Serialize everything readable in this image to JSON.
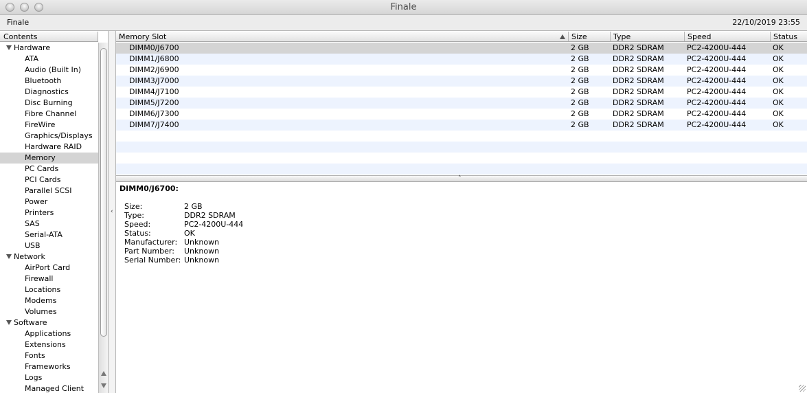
{
  "window": {
    "title": "Finale",
    "machine_name": "Finale",
    "datetime": "22/10/2019 23:55"
  },
  "sidebar": {
    "header": "Contents",
    "categories": [
      {
        "label": "Hardware",
        "items": [
          "ATA",
          "Audio (Built In)",
          "Bluetooth",
          "Diagnostics",
          "Disc Burning",
          "Fibre Channel",
          "FireWire",
          "Graphics/Displays",
          "Hardware RAID",
          "Memory",
          "PC Cards",
          "PCI Cards",
          "Parallel SCSI",
          "Power",
          "Printers",
          "SAS",
          "Serial-ATA",
          "USB"
        ]
      },
      {
        "label": "Network",
        "items": [
          "AirPort Card",
          "Firewall",
          "Locations",
          "Modems",
          "Volumes"
        ]
      },
      {
        "label": "Software",
        "items": [
          "Applications",
          "Extensions",
          "Fonts",
          "Frameworks",
          "Logs",
          "Managed Client"
        ]
      }
    ],
    "selected_item": "Memory"
  },
  "table": {
    "columns": [
      "Memory Slot",
      "Size",
      "Type",
      "Speed",
      "Status"
    ],
    "sorted_column": "Memory Slot",
    "rows": [
      [
        "DIMM0/J6700",
        "2 GB",
        "DDR2 SDRAM",
        "PC2-4200U-444",
        "OK"
      ],
      [
        "DIMM1/J6800",
        "2 GB",
        "DDR2 SDRAM",
        "PC2-4200U-444",
        "OK"
      ],
      [
        "DIMM2/J6900",
        "2 GB",
        "DDR2 SDRAM",
        "PC2-4200U-444",
        "OK"
      ],
      [
        "DIMM3/J7000",
        "2 GB",
        "DDR2 SDRAM",
        "PC2-4200U-444",
        "OK"
      ],
      [
        "DIMM4/J7100",
        "2 GB",
        "DDR2 SDRAM",
        "PC2-4200U-444",
        "OK"
      ],
      [
        "DIMM5/J7200",
        "2 GB",
        "DDR2 SDRAM",
        "PC2-4200U-444",
        "OK"
      ],
      [
        "DIMM6/J7300",
        "2 GB",
        "DDR2 SDRAM",
        "PC2-4200U-444",
        "OK"
      ],
      [
        "DIMM7/J7400",
        "2 GB",
        "DDR2 SDRAM",
        "PC2-4200U-444",
        "OK"
      ]
    ],
    "selected_row": 0
  },
  "details": {
    "title": "DIMM0/J6700:",
    "properties": [
      {
        "key": "Size:",
        "value": "2 GB"
      },
      {
        "key": "Type:",
        "value": "DDR2 SDRAM"
      },
      {
        "key": "Speed:",
        "value": "PC2-4200U-444"
      },
      {
        "key": "Status:",
        "value": "OK"
      },
      {
        "key": "Manufacturer:",
        "value": "Unknown"
      },
      {
        "key": "Part Number:",
        "value": "Unknown"
      },
      {
        "key": "Serial Number:",
        "value": "Unknown"
      }
    ]
  },
  "colors": {
    "selection": "#d4d4d4",
    "stripe": "#edf3fe"
  }
}
